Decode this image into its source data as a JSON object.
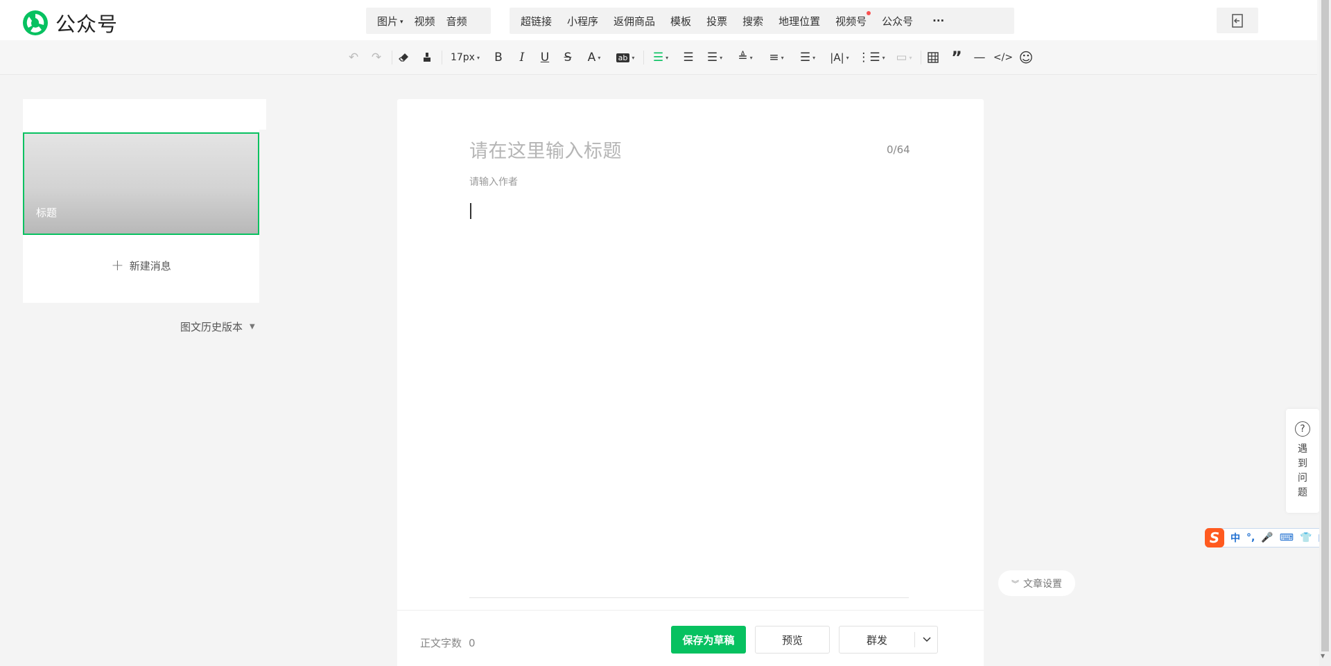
{
  "app": {
    "name": "公众号"
  },
  "insert_bar": {
    "group1": [
      {
        "label": "图片",
        "dropdown": true
      },
      {
        "label": "视频"
      },
      {
        "label": "音频"
      }
    ],
    "group2": [
      {
        "label": "超链接"
      },
      {
        "label": "小程序"
      },
      {
        "label": "返佣商品"
      },
      {
        "label": "模板"
      },
      {
        "label": "投票"
      },
      {
        "label": "搜索"
      },
      {
        "label": "地理位置"
      },
      {
        "label": "视频号",
        "badge": true
      },
      {
        "label": "公众号"
      },
      {
        "label": "···"
      }
    ]
  },
  "toolbar": {
    "font_size": "17px"
  },
  "left_panel": {
    "card_title": "标题",
    "new_message": "新建消息",
    "history": "图文历史版本"
  },
  "editor": {
    "title_placeholder": "请在这里输入标题",
    "title_count": "0/64",
    "author_placeholder": "请输入作者"
  },
  "footer": {
    "word_count_label": "正文字数",
    "word_count": "0",
    "save_draft": "保存为草稿",
    "preview": "预览",
    "publish": "群发"
  },
  "article_settings": "文章设置",
  "help": {
    "icon_text": "?",
    "label": "遇到问题"
  },
  "ime": {
    "items": [
      "中",
      "°,",
      "🎤",
      "⌨",
      "👕",
      "▦"
    ]
  },
  "colors": {
    "accent": "#07c160",
    "badge": "#fa5151"
  }
}
